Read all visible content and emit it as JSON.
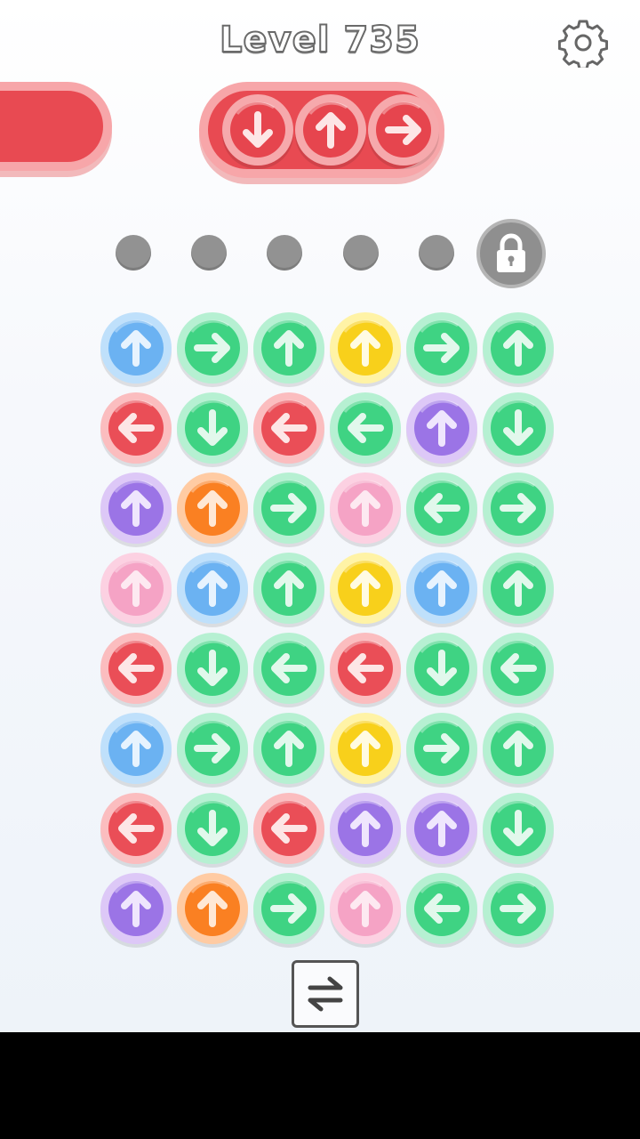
{
  "header": {
    "level_label": "Level 735"
  },
  "icons": {
    "settings": "gear-icon",
    "lock": "lock-icon",
    "swap": "swap-arrows-icon"
  },
  "colors": {
    "blue": {
      "ring": "#bfe0fb",
      "face": "#6bb2f2",
      "arrow": "#e7f3fe"
    },
    "green": {
      "ring": "#b6f0d2",
      "face": "#3fd383",
      "arrow": "#e2f8ec"
    },
    "yellow": {
      "ring": "#fff3a6",
      "face": "#f8d01b",
      "arrow": "#fffbe2"
    },
    "red": {
      "ring": "#fbbdbf",
      "face": "#ea4e57",
      "arrow": "#fde6e6"
    },
    "purple": {
      "ring": "#ddc8f7",
      "face": "#9b74e6",
      "arrow": "#efe6fd"
    },
    "orange": {
      "ring": "#ffcba3",
      "face": "#fa8022",
      "arrow": "#ffe8d5"
    },
    "pink": {
      "ring": "#fcd1e2",
      "face": "#f5a3c5",
      "arrow": "#fde9f1"
    },
    "tray": {
      "ring": "#f6a9ac",
      "face": "#e6454e",
      "arrow": "#fde6e6"
    }
  },
  "tray": {
    "buttons": [
      {
        "color": "tray",
        "dir": "down"
      },
      {
        "color": "tray",
        "dir": "up"
      },
      {
        "color": "tray",
        "dir": "right"
      }
    ]
  },
  "slots": {
    "empty_count": 5,
    "locked_count": 1
  },
  "grid": {
    "rows": [
      [
        {
          "color": "blue",
          "dir": "up"
        },
        {
          "color": "green",
          "dir": "right"
        },
        {
          "color": "green",
          "dir": "up"
        },
        {
          "color": "yellow",
          "dir": "up"
        },
        {
          "color": "green",
          "dir": "right"
        },
        {
          "color": "green",
          "dir": "up"
        }
      ],
      [
        {
          "color": "red",
          "dir": "left"
        },
        {
          "color": "green",
          "dir": "down"
        },
        {
          "color": "red",
          "dir": "left"
        },
        {
          "color": "green",
          "dir": "left"
        },
        {
          "color": "purple",
          "dir": "up"
        },
        {
          "color": "green",
          "dir": "down"
        }
      ],
      [
        {
          "color": "purple",
          "dir": "up"
        },
        {
          "color": "orange",
          "dir": "up"
        },
        {
          "color": "green",
          "dir": "right"
        },
        {
          "color": "pink",
          "dir": "up"
        },
        {
          "color": "green",
          "dir": "left"
        },
        {
          "color": "green",
          "dir": "right"
        }
      ],
      [
        {
          "color": "pink",
          "dir": "up"
        },
        {
          "color": "blue",
          "dir": "up"
        },
        {
          "color": "green",
          "dir": "up"
        },
        {
          "color": "yellow",
          "dir": "up"
        },
        {
          "color": "blue",
          "dir": "up"
        },
        {
          "color": "green",
          "dir": "up"
        }
      ],
      [
        {
          "color": "red",
          "dir": "left"
        },
        {
          "color": "green",
          "dir": "down"
        },
        {
          "color": "green",
          "dir": "left"
        },
        {
          "color": "red",
          "dir": "left"
        },
        {
          "color": "green",
          "dir": "down"
        },
        {
          "color": "green",
          "dir": "left"
        }
      ],
      [
        {
          "color": "blue",
          "dir": "up"
        },
        {
          "color": "green",
          "dir": "right"
        },
        {
          "color": "green",
          "dir": "up"
        },
        {
          "color": "yellow",
          "dir": "up"
        },
        {
          "color": "green",
          "dir": "right"
        },
        {
          "color": "green",
          "dir": "up"
        }
      ],
      [
        {
          "color": "red",
          "dir": "left"
        },
        {
          "color": "green",
          "dir": "down"
        },
        {
          "color": "red",
          "dir": "left"
        },
        {
          "color": "purple",
          "dir": "up"
        },
        {
          "color": "purple",
          "dir": "up"
        },
        {
          "color": "green",
          "dir": "down"
        }
      ],
      [
        {
          "color": "purple",
          "dir": "up"
        },
        {
          "color": "orange",
          "dir": "up"
        },
        {
          "color": "green",
          "dir": "right"
        },
        {
          "color": "pink",
          "dir": "up"
        },
        {
          "color": "green",
          "dir": "left"
        },
        {
          "color": "green",
          "dir": "right"
        }
      ]
    ]
  }
}
